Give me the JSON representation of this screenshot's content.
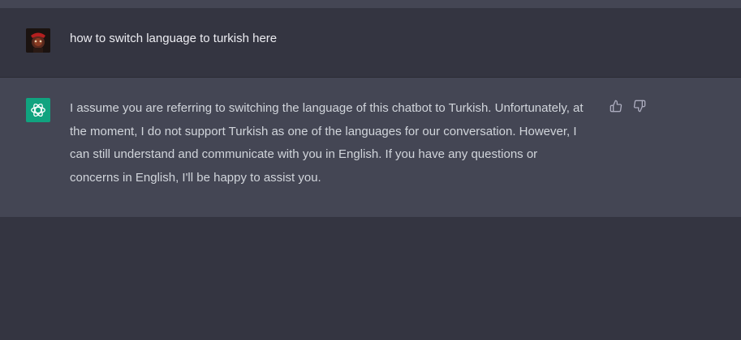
{
  "conversation": {
    "user_message": {
      "text": "how to switch language to turkish here",
      "avatar_icon": "user-avatar-photo"
    },
    "assistant_message": {
      "text": "I assume you are referring to switching the language of this chatbot to Turkish. Unfortunately, at the moment, I do not support Turkish as one of the languages for our conversation. However, I can still understand and communicate with you in English. If you have any questions or concerns in English, I'll be happy to assist you.",
      "avatar_icon": "openai-logo-icon",
      "actions": [
        "thumbs-up-icon",
        "thumbs-down-icon"
      ]
    }
  },
  "colors": {
    "background": "#343541",
    "assistant_background": "#444654",
    "brand_green": "#10a37f",
    "user_text": "#ececf1",
    "assistant_text": "#d1d5db",
    "icon_color": "#acacbe"
  }
}
